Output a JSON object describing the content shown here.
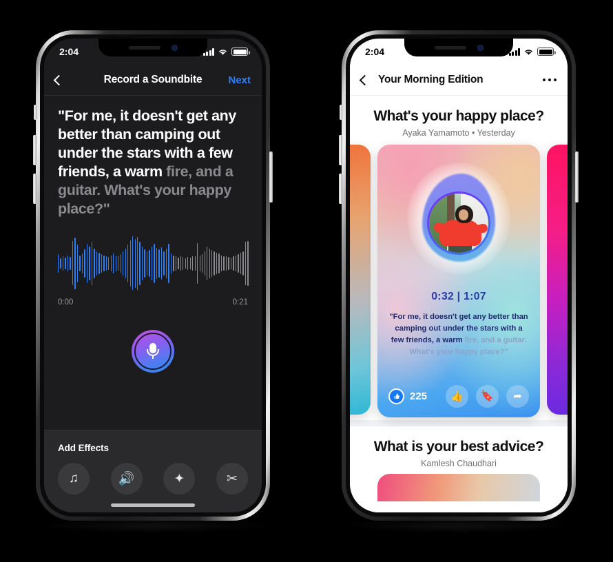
{
  "left_phone": {
    "status_bar": {
      "time": "2:04",
      "signal_icon": "signal-bars-icon",
      "wifi_icon": "wifi-icon",
      "battery_icon": "battery-icon"
    },
    "nav": {
      "back_icon": "chevron-left-icon",
      "title": "Record a Soundbite",
      "next_label": "Next",
      "next_color": "#2D7FF9"
    },
    "transcript": {
      "spoken": "\"For me, it doesn't get any better than camping out under the stars with a few friends, a warm ",
      "remaining": "fire, and a guitar. What's your happy place?\""
    },
    "waveform": {
      "progress_color": "#2D7FF9",
      "remaining_color": "#8A8A8E",
      "played_fraction": 0.6,
      "start_time": "0:00",
      "end_time": "0:21",
      "amplitudes": [
        0.34,
        0.2,
        0.26,
        0.22,
        0.3,
        0.24,
        0.82,
        0.96,
        0.7,
        0.3,
        0.38,
        0.52,
        0.74,
        0.62,
        0.8,
        0.54,
        0.46,
        0.4,
        0.34,
        0.3,
        0.28,
        0.24,
        0.3,
        0.36,
        0.3,
        0.26,
        0.34,
        0.44,
        0.56,
        0.7,
        0.86,
        1.0,
        0.92,
        0.98,
        0.8,
        0.62,
        0.52,
        0.44,
        0.5,
        0.62,
        0.74,
        0.58,
        0.52,
        0.6,
        0.46,
        0.54,
        0.72,
        0.38,
        0.3,
        0.26,
        0.22,
        0.26,
        0.24,
        0.2,
        0.24,
        0.22,
        0.28,
        0.26,
        0.76,
        0.3,
        0.34,
        0.46,
        0.62,
        0.54,
        0.5,
        0.44,
        0.4,
        0.36,
        0.3,
        0.28,
        0.26,
        0.24,
        0.22,
        0.26,
        0.3,
        0.34,
        0.4,
        0.46,
        0.8,
        0.84
      ]
    },
    "record_button": {
      "name": "record-button",
      "icon": "microphone-icon"
    },
    "effects": {
      "title": "Add Effects",
      "items": [
        {
          "name": "music-note-icon",
          "glyph": "♫"
        },
        {
          "name": "sound-effects-icon",
          "glyph": "🔊"
        },
        {
          "name": "sparkles-icon",
          "glyph": "✦"
        },
        {
          "name": "trim-scissors-icon",
          "glyph": "✂"
        }
      ]
    },
    "home_indicator": "home-indicator"
  },
  "right_phone": {
    "status_bar": {
      "time": "2:04",
      "signal_icon": "signal-bars-icon",
      "wifi_icon": "wifi-icon",
      "battery_icon": "battery-icon"
    },
    "nav": {
      "back_icon": "chevron-left-icon",
      "title": "Your Morning Edition",
      "more_icon": "more-options-icon"
    },
    "post": {
      "title": "What's your happy place?",
      "meta": "Ayaka Yamamoto • Yesterday",
      "card": {
        "timer": "0:32 | 1:07",
        "quote_spoken": "\"For me, it doesn't get any better than camping out under the stars with a few friends, a warm ",
        "quote_remaining": "fire, and a guitar. What's your happy place?\"",
        "like_count": "225",
        "like_badge_icon": "thumbs-up-filled-icon",
        "like_badge_glyph": "👍",
        "actions": [
          {
            "name": "like-button",
            "glyph": "👍"
          },
          {
            "name": "save-bookmark-button",
            "glyph": "🔖"
          },
          {
            "name": "share-button",
            "glyph": "➦"
          }
        ],
        "avatar": "avatar",
        "timer_color": "#2B3EA8"
      },
      "peek_left": "carousel-card-previous",
      "peek_right": "carousel-card-next"
    },
    "post2": {
      "title": "What is your best advice?",
      "meta": "Kamlesh Chaudhari"
    }
  }
}
